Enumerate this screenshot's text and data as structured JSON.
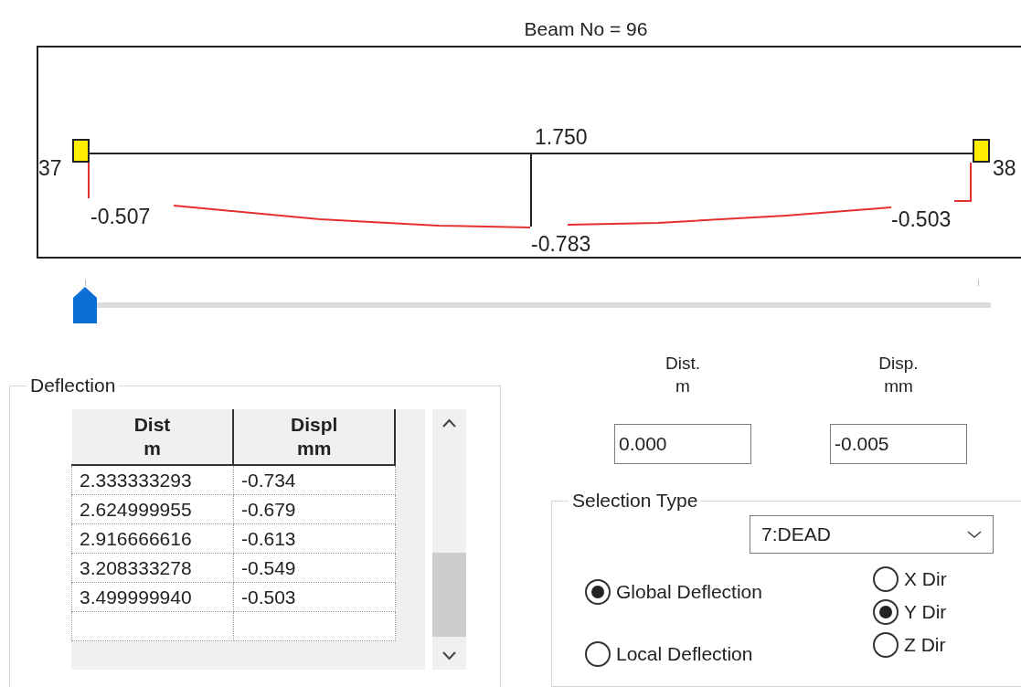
{
  "title": "Beam No = 96",
  "diagram": {
    "start_node": "37",
    "end_node": "38",
    "mid_distance": "1.750",
    "start_deflection": "-0.507",
    "mid_deflection": "-0.783",
    "end_deflection": "-0.503"
  },
  "slider": {
    "level": 0
  },
  "deflection": {
    "title": "Deflection",
    "columns": [
      {
        "label": "Dist",
        "unit": "m"
      },
      {
        "label": "Displ",
        "unit": "mm"
      }
    ],
    "rows": [
      [
        "2.333333293",
        "-0.734"
      ],
      [
        "2.624999955",
        "-0.679"
      ],
      [
        "2.916666616",
        "-0.613"
      ],
      [
        "3.208333278",
        "-0.549"
      ],
      [
        "3.499999940",
        "-0.503"
      ]
    ]
  },
  "readouts": [
    {
      "label": "Dist.",
      "unit": "m",
      "value": "0.000"
    },
    {
      "label": "Disp.",
      "unit": "mm",
      "value": "-0.005"
    }
  ],
  "selection_type": {
    "title": "Selection Type",
    "load_case": "7:DEAD",
    "modes": [
      {
        "label": "Global Deflection",
        "selected": true
      },
      {
        "label": "Local Deflection",
        "selected": false
      }
    ],
    "directions": [
      {
        "label": "X Dir",
        "selected": false
      },
      {
        "label": "Y Dir",
        "selected": true
      },
      {
        "label": "Z Dir",
        "selected": false
      }
    ]
  }
}
